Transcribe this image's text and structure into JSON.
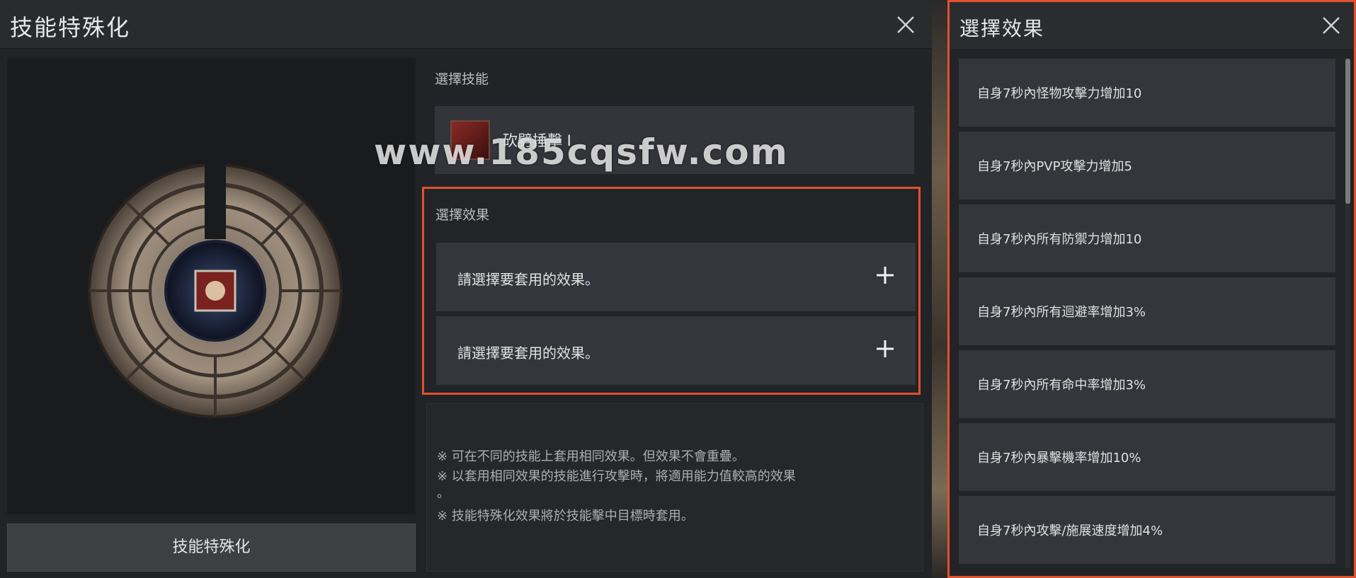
{
  "skill_window": {
    "title": "技能特殊化",
    "close_icon": "close-icon",
    "select_skill_label": "選擇技能",
    "skill": {
      "name": "砍劈捶擊 I",
      "icon": "skill-icon"
    },
    "select_effect_label": "選擇效果",
    "slots": [
      {
        "text": "請選擇要套用的效果。",
        "icon": "plus-icon"
      },
      {
        "text": "請選擇要套用的效果。",
        "icon": "plus-icon"
      }
    ],
    "notes": [
      "※ 可在不同的技能上套用相同效果。但效果不會重疊。",
      "※ 以套用相同效果的技能進行攻擊時，將適用能力值較高的效果",
      "。",
      "※ 技能特殊化效果將於技能擊中目標時套用。"
    ],
    "main_button": "技能特殊化"
  },
  "watermark": "www.185cqsfw.com",
  "effect_window": {
    "title": "選擇效果",
    "close_icon": "close-icon",
    "options": [
      "自身7秒內怪物攻擊力增加10",
      "自身7秒內PVP攻擊力增加5",
      "自身7秒內所有防禦力增加10",
      "自身7秒內所有迴避率增加3%",
      "自身7秒內所有命中率增加3%",
      "自身7秒內暴擊機率增加10%",
      "自身7秒內攻擊/施展速度增加4%"
    ]
  },
  "colors": {
    "highlight": "#e0522f",
    "panel": "#35363b"
  }
}
